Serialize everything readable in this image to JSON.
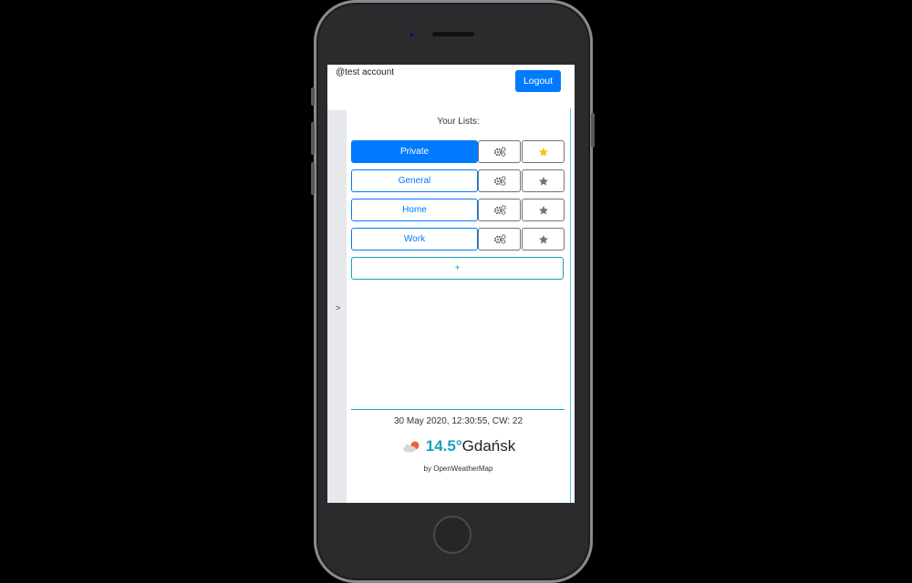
{
  "header": {
    "account": "@test account",
    "logout_label": "Logout"
  },
  "sidebar": {
    "toggle_label": ">"
  },
  "lists": {
    "title": "Your Lists:",
    "items": [
      {
        "label": "Private",
        "active": true,
        "favorite": true
      },
      {
        "label": "General",
        "active": false,
        "favorite": false
      },
      {
        "label": "Home",
        "active": false,
        "favorite": false
      },
      {
        "label": "Work",
        "active": false,
        "favorite": false
      }
    ],
    "add_label": "+"
  },
  "footer": {
    "datetime": "30 May 2020, 12:30:55,  CW: 22",
    "temperature": "14.5°",
    "city": "Gdańsk",
    "attribution": "by OpenWeatherMap"
  },
  "colors": {
    "primary": "#007bff",
    "info": "#17a2b8",
    "secondary": "#6c757d",
    "favorite": "#ffc107"
  },
  "icons": {
    "settings": "cogs-icon",
    "favorite": "star-icon",
    "weather": "partly-cloudy-icon"
  }
}
